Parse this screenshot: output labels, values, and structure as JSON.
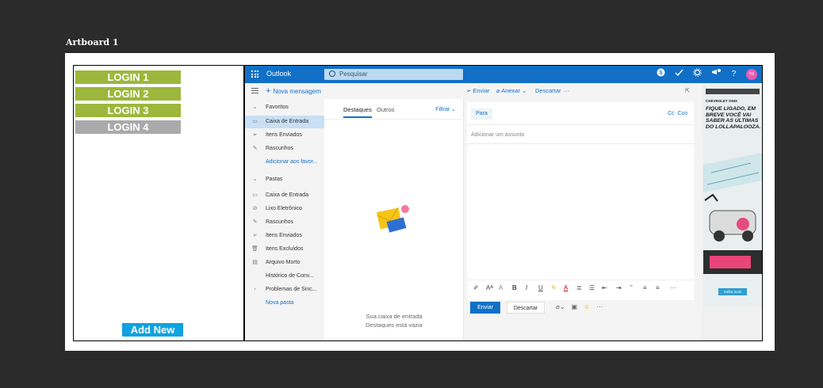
{
  "artboard": {
    "title": "Artboard 1"
  },
  "login_panel": {
    "buttons": [
      {
        "label": "LOGIN 1",
        "color": "#9db73c"
      },
      {
        "label": "LOGIN 2",
        "color": "#9db73c"
      },
      {
        "label": "LOGIN 3",
        "color": "#9db73c"
      },
      {
        "label": "LOGIN 4",
        "color": "#aaaaaa"
      }
    ],
    "add_new_label": "Add New"
  },
  "outlook": {
    "brand": "Outlook",
    "search_placeholder": "Pesquisar",
    "avatar_initials": "HI",
    "new_message": "Nova mensagem",
    "compose_actions": {
      "send": "Enviar",
      "attach": "Anexar",
      "discard": "Descartar",
      "more": "···"
    },
    "folders": {
      "favorites_header": "Favoritos",
      "favorites": [
        "Caixa de Entrada",
        "Itens Enviados",
        "Rascunhos"
      ],
      "add_favorite": "Adicionar aos favor...",
      "folders_header": "Pastas",
      "folders": [
        "Caixa de Entrada",
        "Lixo Eletrônico",
        "Rascunhos",
        "Itens Enviados",
        "Itens Excluídos",
        "Arquivo Morto",
        "Histórico de Conv...",
        "Problemas de Sinc..."
      ],
      "new_folder": "Nova pasta"
    },
    "message_list": {
      "tabs": [
        "Destaques",
        "Outros"
      ],
      "filter": "Filtrar",
      "empty_line1": "Sua caixa de entrada",
      "empty_line2": "Destaques está vazia"
    },
    "compose": {
      "to_label": "Para",
      "cc_label": "Cc",
      "bcc_label": "Cco",
      "subject_placeholder": "Adicionar um assunto",
      "send_button": "Enviar",
      "discard_button": "Descartar"
    },
    "ad": {
      "small_label": "CHEVROLET ONIX",
      "headline": "FIQUE LIGADO, EM BREVE VOCÊ VAI SABER AS ÚLTIMAS DO LOLLAPALOOZA.",
      "cta": "Saiba mais"
    }
  }
}
